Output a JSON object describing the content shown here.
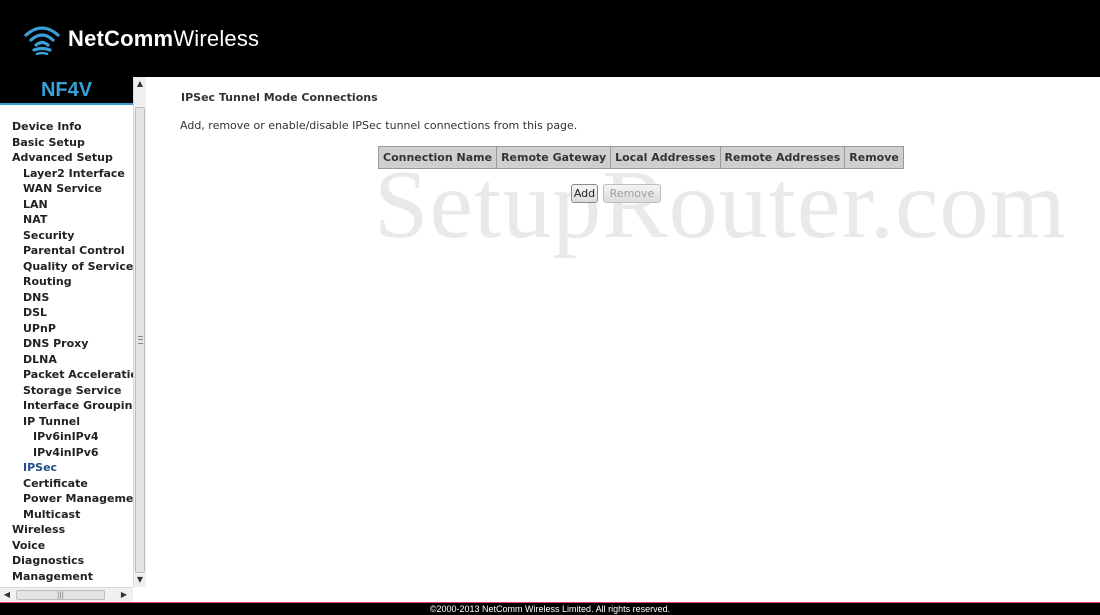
{
  "header": {
    "brand_bold": "NetComm",
    "brand_light": "Wireless"
  },
  "sidebar": {
    "model": "NF4V",
    "active_item": "IPSec",
    "items": [
      {
        "label": "Device Info",
        "level": 0
      },
      {
        "label": "Basic Setup",
        "level": 0
      },
      {
        "label": "Advanced Setup",
        "level": 0
      },
      {
        "label": "Layer2 Interface",
        "level": 1
      },
      {
        "label": "WAN Service",
        "level": 1
      },
      {
        "label": "LAN",
        "level": 1
      },
      {
        "label": "NAT",
        "level": 1
      },
      {
        "label": "Security",
        "level": 1
      },
      {
        "label": "Parental Control",
        "level": 1
      },
      {
        "label": "Quality of Service",
        "level": 1
      },
      {
        "label": "Routing",
        "level": 1
      },
      {
        "label": "DNS",
        "level": 1
      },
      {
        "label": "DSL",
        "level": 1
      },
      {
        "label": "UPnP",
        "level": 1
      },
      {
        "label": "DNS Proxy",
        "level": 1
      },
      {
        "label": "DLNA",
        "level": 1
      },
      {
        "label": "Packet Acceleration",
        "level": 1
      },
      {
        "label": "Storage Service",
        "level": 1
      },
      {
        "label": "Interface Grouping",
        "level": 1
      },
      {
        "label": "IP Tunnel",
        "level": 1
      },
      {
        "label": "IPv6inIPv4",
        "level": 2
      },
      {
        "label": "IPv4inIPv6",
        "level": 2
      },
      {
        "label": "IPSec",
        "level": 1
      },
      {
        "label": "Certificate",
        "level": 1
      },
      {
        "label": "Power Management",
        "level": 1
      },
      {
        "label": "Multicast",
        "level": 1
      },
      {
        "label": "Wireless",
        "level": 0
      },
      {
        "label": "Voice",
        "level": 0
      },
      {
        "label": "Diagnostics",
        "level": 0
      },
      {
        "label": "Management",
        "level": 0
      }
    ]
  },
  "main": {
    "title": "IPSec Tunnel Mode Connections",
    "description": "Add, remove or enable/disable IPSec tunnel connections from this page.",
    "table_headers": [
      "Connection Name",
      "Remote Gateway",
      "Local Addresses",
      "Remote Addresses",
      "Remove"
    ],
    "add_label": "Add",
    "remove_label": "Remove",
    "watermark": "SetupRouter.com"
  },
  "footer": {
    "copyright": "©2000-2013 NetComm Wireless Limited. All rights reserved."
  },
  "colors": {
    "accent": "#3aa0d8",
    "active_nav": "#1f4f86",
    "header_bg": "#000000",
    "footer_rule": "#e0406a"
  }
}
